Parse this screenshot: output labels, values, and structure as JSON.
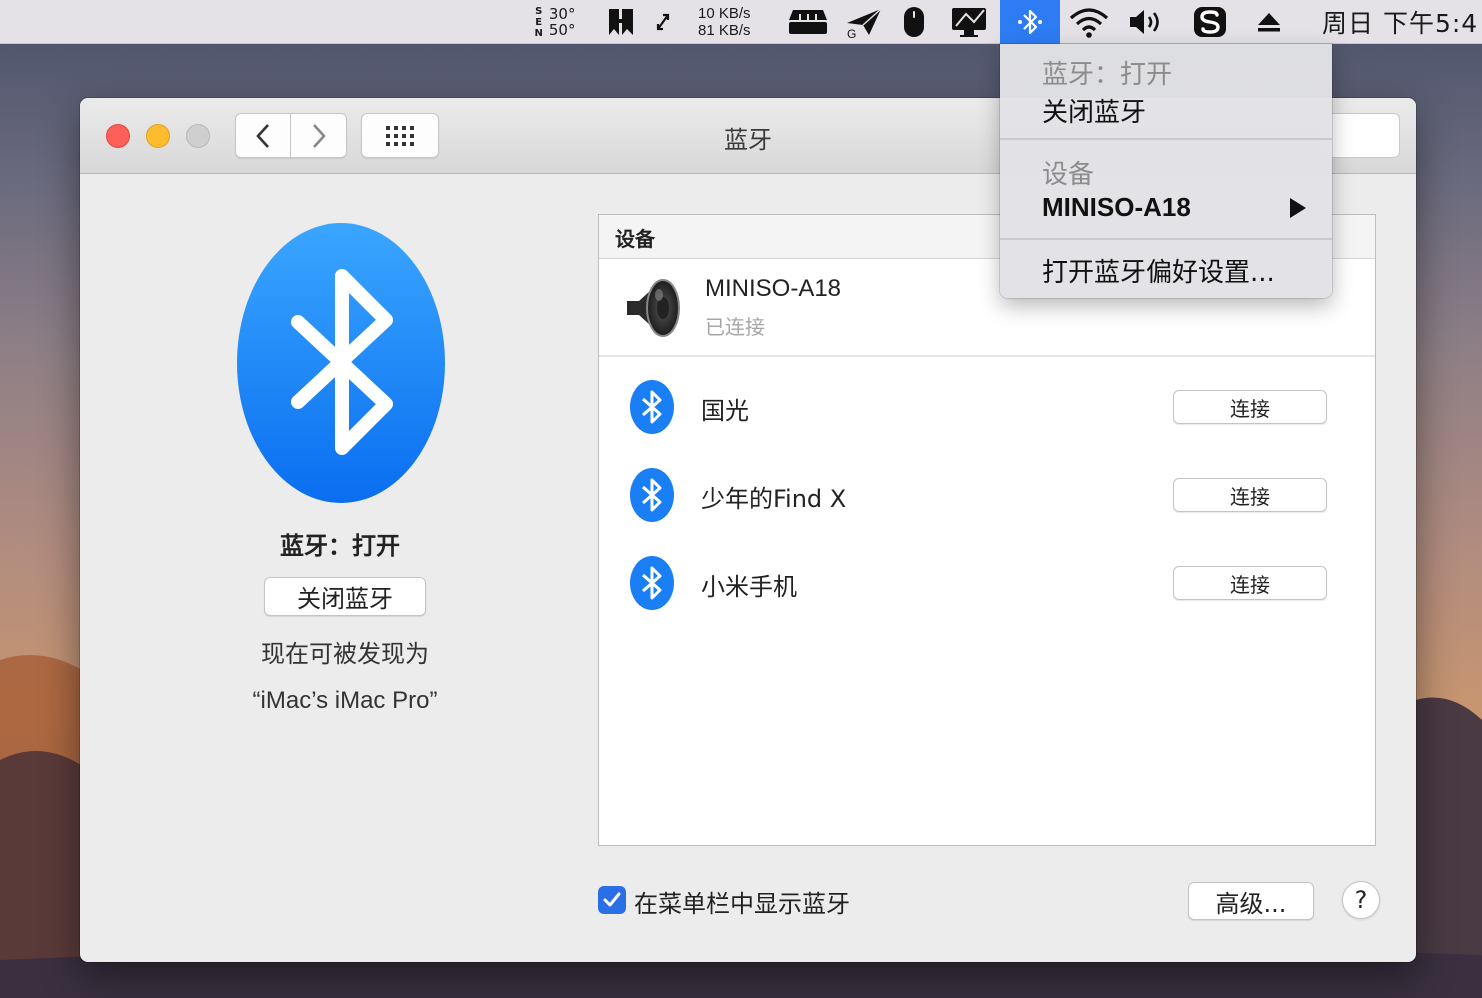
{
  "menubar": {
    "temp_high": "30°",
    "temp_low": "50°",
    "temp_dirs": [
      "S",
      "E",
      "N"
    ],
    "net_up": "10 KB/s",
    "net_down": "81 KB/s",
    "clock": "周日 下午5:4"
  },
  "window": {
    "title": "蓝牙"
  },
  "left_pane": {
    "status": "蓝牙：打开",
    "toggle_button": "关闭蓝牙",
    "discoverable_text": "现在可被发现为",
    "device_name": "“iMac’s iMac Pro”"
  },
  "device_list": {
    "header": "设备",
    "connected": {
      "name": "MINISO-A18",
      "status": "已连接"
    },
    "devices": [
      {
        "name": "国光",
        "button": "连接"
      },
      {
        "name": "少年的Find X",
        "button": "连接"
      },
      {
        "name": "小米手机",
        "button": "连接"
      }
    ]
  },
  "bottom": {
    "show_in_menubar_label": "在菜单栏中显示蓝牙",
    "show_in_menubar_checked": true,
    "advanced_button": "高级...",
    "help_button": "?"
  },
  "dropdown": {
    "status": "蓝牙：打开",
    "toggle": "关闭蓝牙",
    "devices_header": "设备",
    "device": "MINISO-A18",
    "open_prefs": "打开蓝牙偏好设置..."
  },
  "colors": {
    "accent": "#2d7cf3",
    "bluetooth_blue": "#1a7ef5",
    "close": "#fc5f57",
    "minimize": "#fdbc2e"
  }
}
